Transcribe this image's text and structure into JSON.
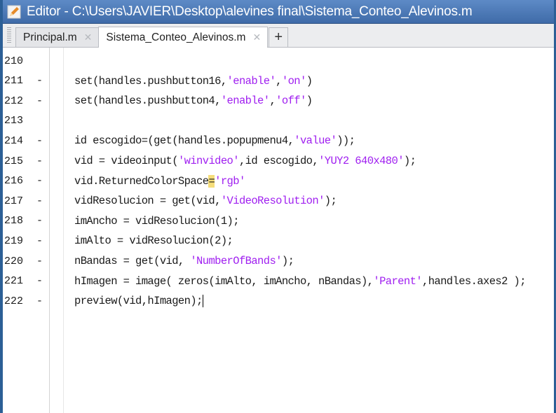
{
  "window": {
    "title": "Editor - C:\\Users\\JAVIER\\Desktop\\alevines final\\Sistema_Conteo_Alevinos.m"
  },
  "tabs": [
    {
      "label": "Principal.m",
      "active": false
    },
    {
      "label": "Sistema_Conteo_Alevinos.m",
      "active": true
    }
  ],
  "tab_add_label": "+",
  "tab_close_glyph": "✕",
  "colors": {
    "string": "#a020f0",
    "title_bar": "#4a78b8",
    "highlight": "#f5dd7a"
  },
  "lines": [
    {
      "num": "210",
      "dash": "",
      "segments": []
    },
    {
      "num": "211",
      "dash": "-",
      "segments": [
        {
          "t": "set(handles.pushbutton16,",
          "s": false
        },
        {
          "t": "'enable'",
          "s": true
        },
        {
          "t": ",",
          "s": false
        },
        {
          "t": "'on'",
          "s": true
        },
        {
          "t": ")",
          "s": false
        }
      ]
    },
    {
      "num": "212",
      "dash": "-",
      "segments": [
        {
          "t": "set(handles.pushbutton4,",
          "s": false
        },
        {
          "t": "'enable'",
          "s": true
        },
        {
          "t": ",",
          "s": false
        },
        {
          "t": "'off'",
          "s": true
        },
        {
          "t": ")",
          "s": false
        }
      ]
    },
    {
      "num": "213",
      "dash": "",
      "segments": []
    },
    {
      "num": "214",
      "dash": "-",
      "segments": [
        {
          "t": "id escogido=(get(handles.popupmenu4,",
          "s": false
        },
        {
          "t": "'value'",
          "s": true
        },
        {
          "t": "));",
          "s": false
        }
      ]
    },
    {
      "num": "215",
      "dash": "-",
      "segments": [
        {
          "t": "vid = videoinput(",
          "s": false
        },
        {
          "t": "'winvideo'",
          "s": true
        },
        {
          "t": ",id escogido,",
          "s": false
        },
        {
          "t": "'YUY2 640x480'",
          "s": true
        },
        {
          "t": ");",
          "s": false
        }
      ]
    },
    {
      "num": "216",
      "dash": "-",
      "segments": [
        {
          "t": "vid.ReturnedColorSpace",
          "s": false
        },
        {
          "t": "=",
          "s": false,
          "hl": true
        },
        {
          "t": "'rgb'",
          "s": true
        }
      ]
    },
    {
      "num": "217",
      "dash": "-",
      "segments": [
        {
          "t": "vidResolucion = get(vid,",
          "s": false
        },
        {
          "t": "'VideoResolution'",
          "s": true
        },
        {
          "t": ");",
          "s": false
        }
      ]
    },
    {
      "num": "218",
      "dash": "-",
      "segments": [
        {
          "t": "imAncho = vidResolucion(1);",
          "s": false
        }
      ]
    },
    {
      "num": "219",
      "dash": "-",
      "segments": [
        {
          "t": "imAlto = vidResolucion(2);",
          "s": false
        }
      ]
    },
    {
      "num": "220",
      "dash": "-",
      "segments": [
        {
          "t": "nBandas = get(vid, ",
          "s": false
        },
        {
          "t": "'NumberOfBands'",
          "s": true
        },
        {
          "t": ");",
          "s": false
        }
      ]
    },
    {
      "num": "221",
      "dash": "-",
      "segments": [
        {
          "t": "hImagen = image( zeros(imAlto, imAncho, nBandas),",
          "s": false
        },
        {
          "t": "'Parent'",
          "s": true
        },
        {
          "t": ",handles.axes2 );",
          "s": false
        }
      ]
    },
    {
      "num": "222",
      "dash": "-",
      "segments": [
        {
          "t": "preview(vid,hImagen);",
          "s": false,
          "cursor": true
        }
      ]
    }
  ]
}
